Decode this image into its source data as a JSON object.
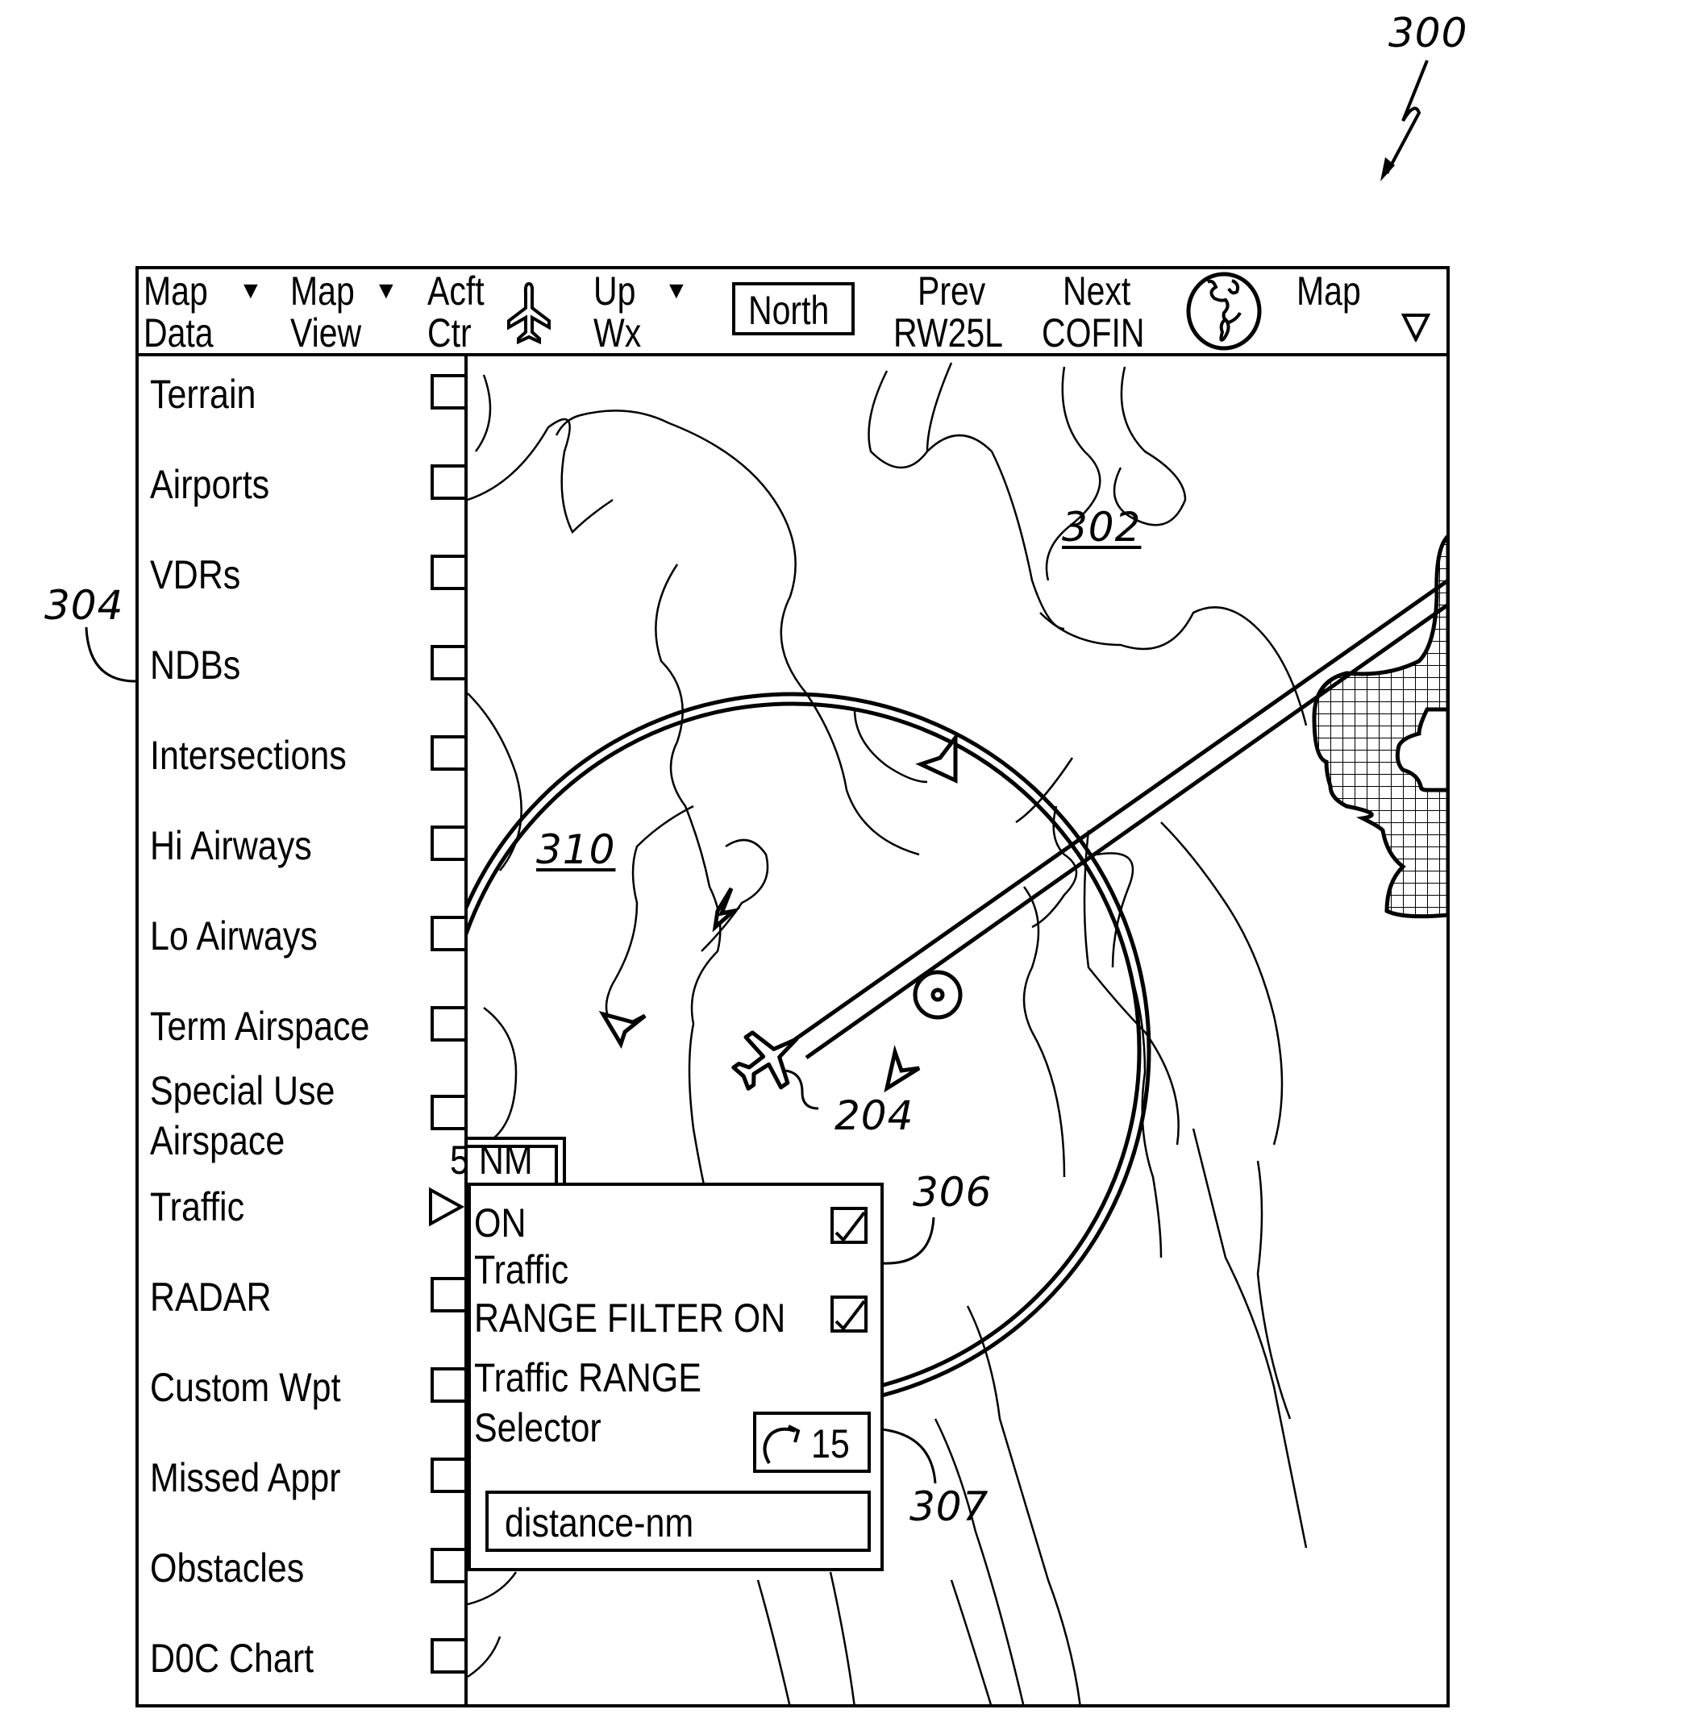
{
  "figure": {
    "ref_main": "300",
    "ref_map": "302",
    "ref_sidebar": "304",
    "ref_popup": "306",
    "ref_range_selector": "307",
    "ref_range_ring": "310",
    "ref_ownship": "204"
  },
  "toolbar": {
    "map_data": {
      "line1": "Map",
      "line2": "Data",
      "icon": "dropdown-triangle-icon"
    },
    "map_view": {
      "line1": "Map",
      "line2": "View",
      "icon": "dropdown-triangle-icon"
    },
    "acft_ctr": {
      "line1": "Acft",
      "line2": "Ctr",
      "icon": "airplane-icon"
    },
    "up_wx": {
      "line1": "Up",
      "line2": "Wx",
      "icon": "dropdown-triangle-icon"
    },
    "orientation_value": "North",
    "prev": {
      "line1": "Prev",
      "line2": "RW25L"
    },
    "next": {
      "line1": "Next",
      "line2": "COFIN"
    },
    "globe_icon": "globe-icon",
    "map_menu": {
      "line1": "Map",
      "icon": "dropdown-triangle-icon"
    }
  },
  "sidebar": {
    "items": [
      {
        "label": "Terrain",
        "control": "checkbox",
        "checked": false
      },
      {
        "label": "Airports",
        "control": "checkbox",
        "checked": false
      },
      {
        "label": "VDRs",
        "control": "checkbox",
        "checked": false
      },
      {
        "label": "NDBs",
        "control": "checkbox",
        "checked": false
      },
      {
        "label": "Intersections",
        "control": "checkbox",
        "checked": false
      },
      {
        "label": "Hi Airways",
        "control": "checkbox",
        "checked": false
      },
      {
        "label": "Lo Airways",
        "control": "checkbox",
        "checked": false
      },
      {
        "label": "Term Airspace",
        "control": "checkbox",
        "checked": false
      },
      {
        "label": "Special Use",
        "label2": "Airspace",
        "control": "checkbox",
        "checked": false
      },
      {
        "label": "Traffic",
        "control": "expand-arrow",
        "expanded": true
      },
      {
        "label": "RADAR",
        "control": "checkbox",
        "checked": false
      },
      {
        "label": "Custom Wpt",
        "control": "checkbox",
        "checked": false
      },
      {
        "label": "Missed Appr",
        "control": "checkbox",
        "checked": false
      },
      {
        "label": "Obstacles",
        "control": "checkbox",
        "checked": false
      },
      {
        "label": "D0C Chart",
        "control": "checkbox",
        "checked": false
      }
    ]
  },
  "map": {
    "scale_label": "5 NM"
  },
  "traffic_popup": {
    "on_label_1": "ON",
    "on_label_2": "Traffic",
    "traffic_on_checked": true,
    "range_filter_label": "RANGE FILTER ON",
    "range_filter_checked": true,
    "range_label_1": "Traffic RANGE",
    "range_label_2": "Selector",
    "range_value": "15",
    "range_units": "distance-nm"
  }
}
